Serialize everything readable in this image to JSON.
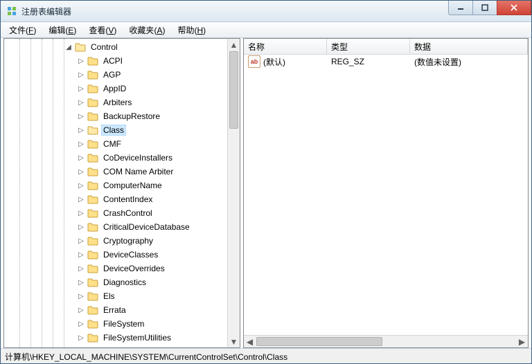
{
  "window": {
    "title": "注册表编辑器"
  },
  "menu": {
    "file": {
      "label": "文件",
      "accel": "F"
    },
    "edit": {
      "label": "编辑",
      "accel": "E"
    },
    "view": {
      "label": "查看",
      "accel": "V"
    },
    "fav": {
      "label": "收藏夹",
      "accel": "A"
    },
    "help": {
      "label": "帮助",
      "accel": "H"
    }
  },
  "tree": {
    "root": {
      "label": "Control",
      "expanded": true
    },
    "items": [
      {
        "label": "ACPI"
      },
      {
        "label": "AGP"
      },
      {
        "label": "AppID"
      },
      {
        "label": "Arbiters"
      },
      {
        "label": "BackupRestore"
      },
      {
        "label": "Class",
        "selected": true
      },
      {
        "label": "CMF"
      },
      {
        "label": "CoDeviceInstallers"
      },
      {
        "label": "COM Name Arbiter"
      },
      {
        "label": "ComputerName"
      },
      {
        "label": "ContentIndex"
      },
      {
        "label": "CrashControl"
      },
      {
        "label": "CriticalDeviceDatabase"
      },
      {
        "label": "Cryptography"
      },
      {
        "label": "DeviceClasses"
      },
      {
        "label": "DeviceOverrides"
      },
      {
        "label": "Diagnostics"
      },
      {
        "label": "Els"
      },
      {
        "label": "Errata"
      },
      {
        "label": "FileSystem"
      },
      {
        "label": "FileSystemUtilities"
      }
    ]
  },
  "list": {
    "columns": {
      "name": "名称",
      "type": "类型",
      "data": "数据"
    },
    "rows": [
      {
        "name": "(默认)",
        "type": "REG_SZ",
        "data": "(数值未设置)"
      }
    ]
  },
  "status": {
    "path": "计算机\\HKEY_LOCAL_MACHINE\\SYSTEM\\CurrentControlSet\\Control\\Class"
  },
  "icons": {
    "expander_collapsed": "▷",
    "expander_expanded": "◢"
  }
}
